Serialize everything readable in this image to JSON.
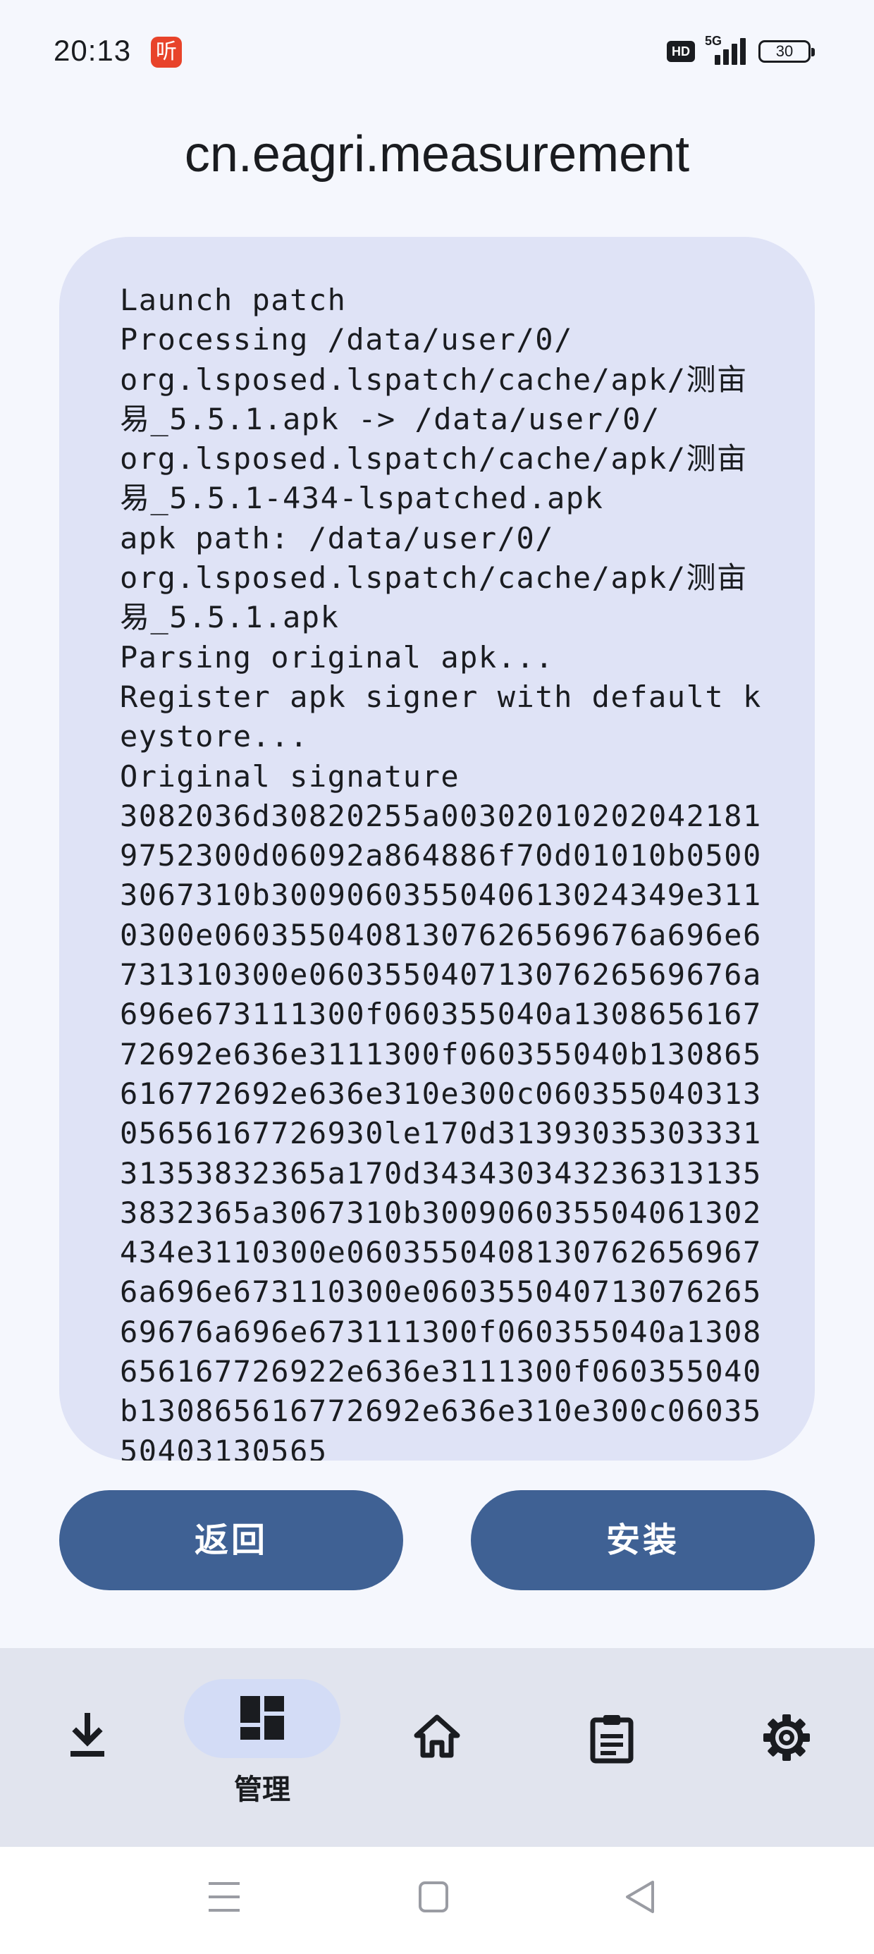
{
  "status_bar": {
    "time": "20:13",
    "app_notification_glyph": "听",
    "hd_badge": "HD",
    "network_label": "5G",
    "battery_level": "30"
  },
  "page": {
    "title": "cn.eagri.measurement"
  },
  "log": {
    "text": "Launch patch\nProcessing /data/user/0/\norg.lsposed.lspatch/cache/apk/测亩易_5.5.1.apk -> /data/user/0/\norg.lsposed.lspatch/cache/apk/测亩易_5.5.1-434-lspatched.apk\napk path: /data/user/0/\norg.lsposed.lspatch/cache/apk/测亩易_5.5.1.apk\nParsing original apk...\nRegister apk signer with default keystore...\nOriginal signature\n3082036d30820255a003020102020421819752300d06092a864886f70d01010b05003067310b3009060355040613024349e3110300e06035504081307626569676a696e6731310300e06035504071307626569676a696e673111300f060355040a130865616772692e636e3111300f060355040b130865616772692e636e310e300c06035504031305656167726930le170d3139303530333131353832365a170d3434303432363131353832365a3067310b300906035504061302434e3110300e06035504081307626569676a696e673110300e06035504071307626569676a696e673111300f060355040a1308656167726922e636e3111300f060355040b130865616772692e636e310e300c0603550403130565"
  },
  "actions": {
    "back_label": "返回",
    "install_label": "安装"
  },
  "bottom_nav": {
    "items": [
      {
        "icon": "download-icon",
        "label": ""
      },
      {
        "icon": "dashboard-icon",
        "label": "管理",
        "selected": true
      },
      {
        "icon": "home-icon",
        "label": ""
      },
      {
        "icon": "clipboard-icon",
        "label": ""
      },
      {
        "icon": "gear-icon",
        "label": ""
      }
    ]
  },
  "colors": {
    "background": "#f5f7fd",
    "card": "#dfe3f6",
    "button": "#3f6194",
    "nav_bar": "#e1e4ee",
    "nav_selected_pill": "#d3dcf6"
  }
}
